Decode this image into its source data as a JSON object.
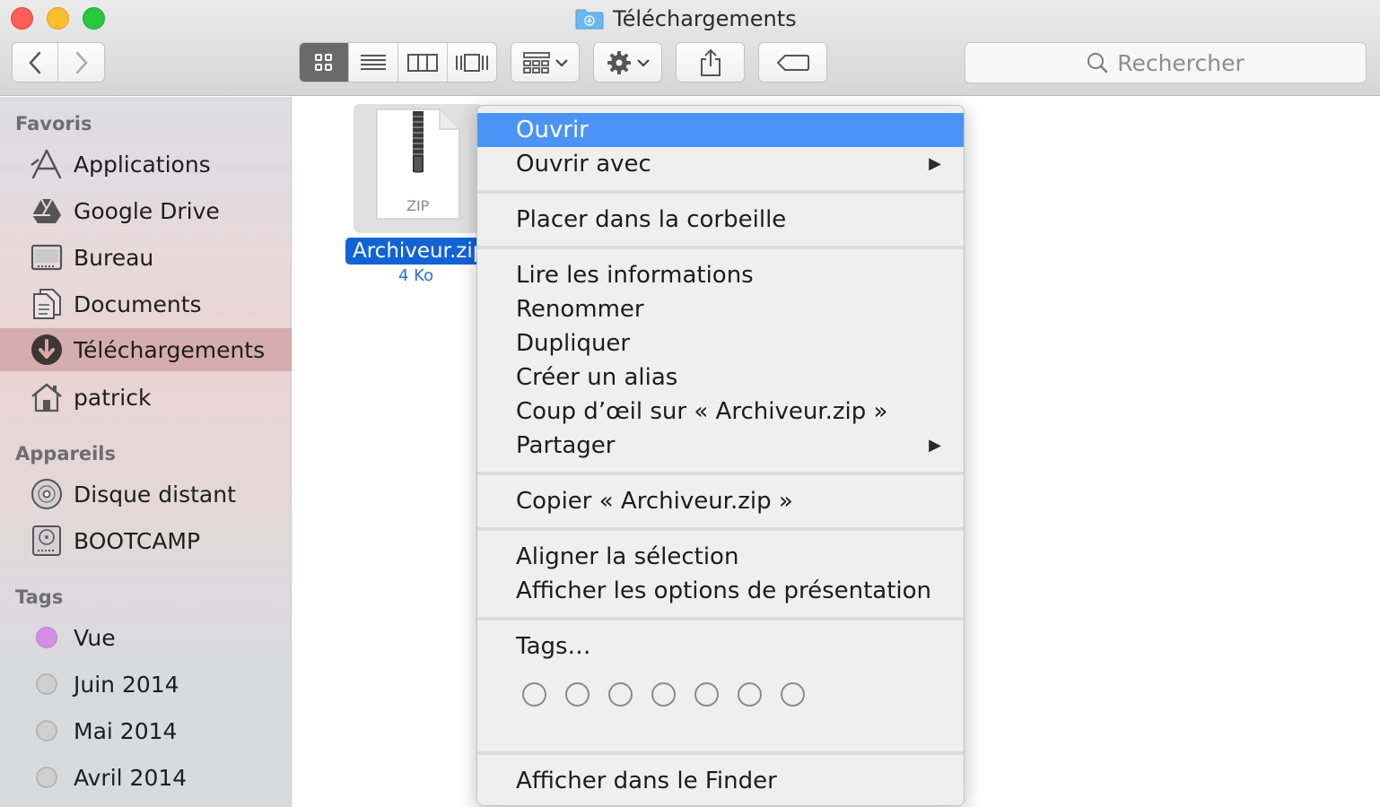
{
  "window": {
    "title": "Téléchargements"
  },
  "toolbar": {
    "back_icon": "chevron-left-icon",
    "forward_icon": "chevron-right-icon",
    "view_modes": [
      "icon-view",
      "list-view",
      "column-view",
      "cover-flow-view"
    ],
    "active_view": "icon-view",
    "arrange_icon": "arrange-grid-icon",
    "action_icon": "gear-icon",
    "share_icon": "share-icon",
    "tag_icon": "tag-icon",
    "search_placeholder": "Rechercher"
  },
  "sidebar": {
    "sections": [
      {
        "heading": "Favoris",
        "items": [
          {
            "label": "Applications",
            "icon": "applications-icon"
          },
          {
            "label": "Google Drive",
            "icon": "google-drive-icon"
          },
          {
            "label": "Bureau",
            "icon": "desktop-icon"
          },
          {
            "label": "Documents",
            "icon": "documents-icon"
          },
          {
            "label": "Téléchargements",
            "icon": "downloads-icon",
            "selected": true
          },
          {
            "label": "patrick",
            "icon": "home-icon"
          }
        ]
      },
      {
        "heading": "Appareils",
        "items": [
          {
            "label": "Disque distant",
            "icon": "remote-disc-icon"
          },
          {
            "label": "BOOTCAMP",
            "icon": "drive-icon"
          }
        ]
      },
      {
        "heading": "Tags",
        "items": [
          {
            "label": "Vue",
            "color": "#d58ee6"
          },
          {
            "label": "Juin 2014",
            "color": "#c9c9c9"
          },
          {
            "label": "Mai 2014",
            "color": "#c9c9c9"
          },
          {
            "label": "Avril 2014",
            "color": "#c9c9c9"
          }
        ]
      }
    ]
  },
  "file": {
    "name": "Archiveur.zip",
    "size": "4 Ko",
    "type_label": "ZIP"
  },
  "context_menu": {
    "groups": [
      [
        {
          "label": "Ouvrir",
          "highlighted": true
        },
        {
          "label": "Ouvrir avec",
          "submenu": true
        }
      ],
      [
        {
          "label": "Placer dans la corbeille"
        }
      ],
      [
        {
          "label": "Lire les informations"
        },
        {
          "label": "Renommer"
        },
        {
          "label": "Dupliquer"
        },
        {
          "label": "Créer un alias"
        },
        {
          "label": "Coup d’œil sur « Archiveur.zip »"
        },
        {
          "label": "Partager",
          "submenu": true
        }
      ],
      [
        {
          "label": "Copier « Archiveur.zip »"
        }
      ],
      [
        {
          "label": "Aligner la sélection"
        },
        {
          "label": "Afficher les options de présentation"
        }
      ],
      [
        {
          "label": "Tags…"
        }
      ],
      [
        {
          "label": "Afficher dans le Finder"
        }
      ]
    ],
    "submenu_arrow": "▶",
    "tag_color_count": 7
  }
}
